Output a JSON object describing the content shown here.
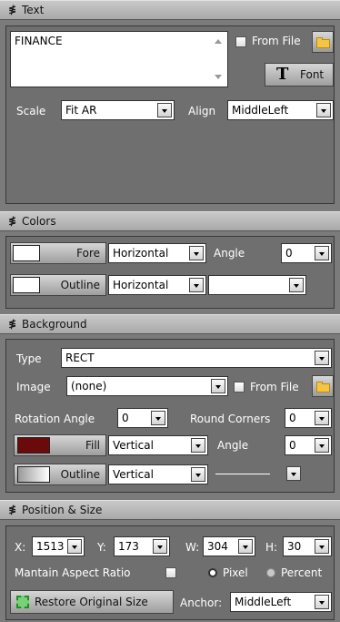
{
  "text_section": {
    "header": "Text",
    "text_value": "FINANCE",
    "from_file_label": "From File",
    "font_label": "Font",
    "font_glyph": "T",
    "scale_label": "Scale",
    "scale_value": "Fit AR",
    "align_label": "Align",
    "align_value": "MiddleLeft"
  },
  "colors_section": {
    "header": "Colors",
    "fore_label": "Fore",
    "fore_color": "#ffffff",
    "fore_gradient": "Horizontal",
    "angle_label": "Angle",
    "angle_value": "0",
    "outline_label": "Outline",
    "outline_color": "#ffffff",
    "outline_gradient": "Horizontal",
    "outline_style": ""
  },
  "background_section": {
    "header": "Background",
    "type_label": "Type",
    "type_value": "RECT",
    "image_label": "Image",
    "image_value": "(none)",
    "from_file_label": "From File",
    "rotation_label": "Rotation Angle",
    "rotation_value": "0",
    "round_corners_label": "Round Corners",
    "round_corners_value": "0",
    "fill_label": "Fill",
    "fill_color": "#6b0a0a",
    "fill_gradient": "Vertical",
    "angle_label": "Angle",
    "angle_value": "0",
    "outline_label": "Outline",
    "outline_gradient": "Vertical"
  },
  "position_section": {
    "header": "Position & Size",
    "x_label": "X:",
    "x_value": "1513",
    "y_label": "Y:",
    "y_value": "173",
    "w_label": "W:",
    "w_value": "304",
    "h_label": "H:",
    "h_value": "30",
    "aspect_label": "Mantain Aspect Ratio",
    "pixel_label": "Pixel",
    "percent_label": "Percent",
    "restore_label": "Restore Original Size",
    "anchor_label": "Anchor:",
    "anchor_value": "MiddleLeft"
  }
}
